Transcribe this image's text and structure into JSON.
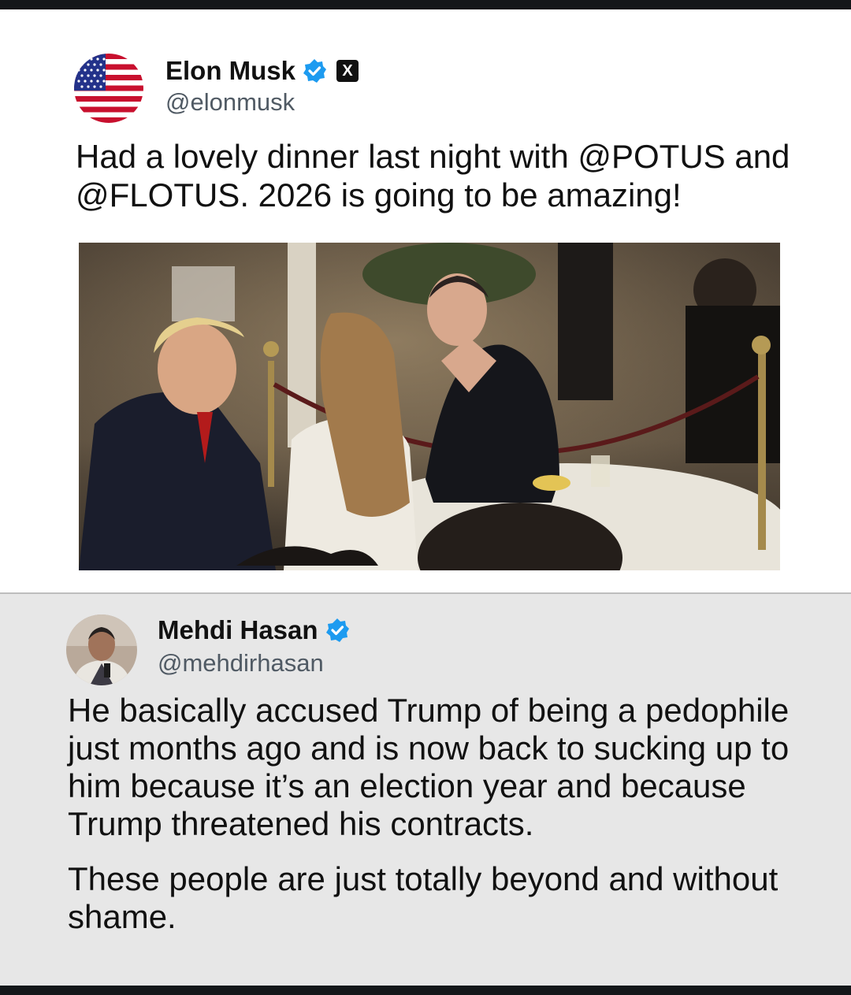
{
  "original_post": {
    "author_name": "Elon Musk",
    "author_handle": "@elonmusk",
    "verified": true,
    "affiliate_badge": "X",
    "text": "Had a lovely dinner last night with @POTUS and @FLOTUS. 2026 is going to be amazing!",
    "avatar_icon": "us-flag-avatar",
    "image_icon": "dinner-photo"
  },
  "reply_post": {
    "author_name": "Mehdi Hasan",
    "author_handle": "@mehdirhasan",
    "verified": true,
    "avatar_icon": "person-avatar",
    "paragraphs": [
      "He basically accused Trump of being a pedophile just months ago and is now back to sucking up to him because it’s an election year and because Trump threatened his contracts.",
      "These people are just totally beyond and without shame."
    ]
  },
  "colors": {
    "verified_blue": "#1d9bf0",
    "top_background": "#ffffff",
    "reply_background": "#e7e7e7",
    "text": "#111111",
    "handle": "#505a64"
  }
}
